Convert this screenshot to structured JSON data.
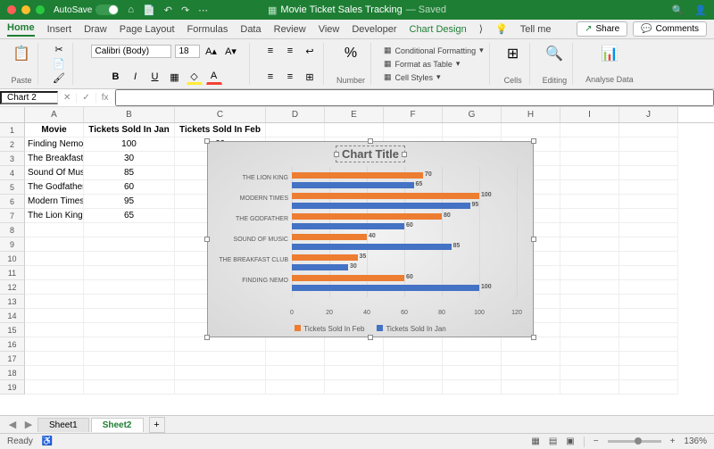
{
  "titlebar": {
    "autosave_label": "AutoSave",
    "doc_icon": "x",
    "doc_name": "Movie Ticket Sales Tracking",
    "doc_status": "— Saved"
  },
  "tabs": {
    "items": [
      "Home",
      "Insert",
      "Draw",
      "Page Layout",
      "Formulas",
      "Data",
      "Review",
      "View",
      "Developer",
      "Chart Design"
    ],
    "active": "Home",
    "tellme": "Tell me",
    "share": "Share",
    "comments": "Comments"
  },
  "ribbon": {
    "paste_label": "Paste",
    "font_name": "Calibri (Body)",
    "font_size": "18",
    "number_label": "Number",
    "percent": "%",
    "cond_fmt": "Conditional Formatting",
    "fmt_table": "Format as Table",
    "cell_styles": "Cell Styles",
    "cells_label": "Cells",
    "editing_label": "Editing",
    "analyse_label": "Analyse Data"
  },
  "namebox": {
    "value": "Chart 2",
    "fx": "fx"
  },
  "columns": [
    "A",
    "B",
    "C",
    "D",
    "E",
    "F",
    "G",
    "H",
    "I",
    "J"
  ],
  "headers": {
    "a": "Movie",
    "b": "Tickets Sold In Jan",
    "c": "Tickets Sold In Feb"
  },
  "table": [
    {
      "a": "Finding Nemo",
      "b": "100",
      "c": "60"
    },
    {
      "a": "The Breakfast Club",
      "b": "30",
      "c": ""
    },
    {
      "a": "Sound Of Music",
      "b": "85",
      "c": ""
    },
    {
      "a": "The Godfather",
      "b": "60",
      "c": ""
    },
    {
      "a": "Modern Times",
      "b": "95",
      "c": ""
    },
    {
      "a": "The Lion King",
      "b": "65",
      "c": ""
    }
  ],
  "chart_data": {
    "type": "bar",
    "title": "Chart Title",
    "categories": [
      "THE LION KING",
      "MODERN TIMES",
      "THE GODFATHER",
      "SOUND OF MUSIC",
      "THE BREAKFAST CLUB",
      "FINDING NEMO"
    ],
    "series": [
      {
        "name": "Tickets Sold In Feb",
        "color": "#ed7d31",
        "values": [
          70,
          100,
          80,
          40,
          35,
          60
        ]
      },
      {
        "name": "Tickets Sold In Jan",
        "color": "#4472C4",
        "values": [
          65,
          95,
          60,
          85,
          30,
          100
        ]
      }
    ],
    "xticks": [
      0,
      20,
      40,
      60,
      80,
      100,
      120
    ],
    "xmax": 120
  },
  "sheets": {
    "items": [
      "Sheet1",
      "Sheet2"
    ],
    "active": "Sheet2"
  },
  "status": {
    "ready": "Ready",
    "zoom": "136%"
  }
}
